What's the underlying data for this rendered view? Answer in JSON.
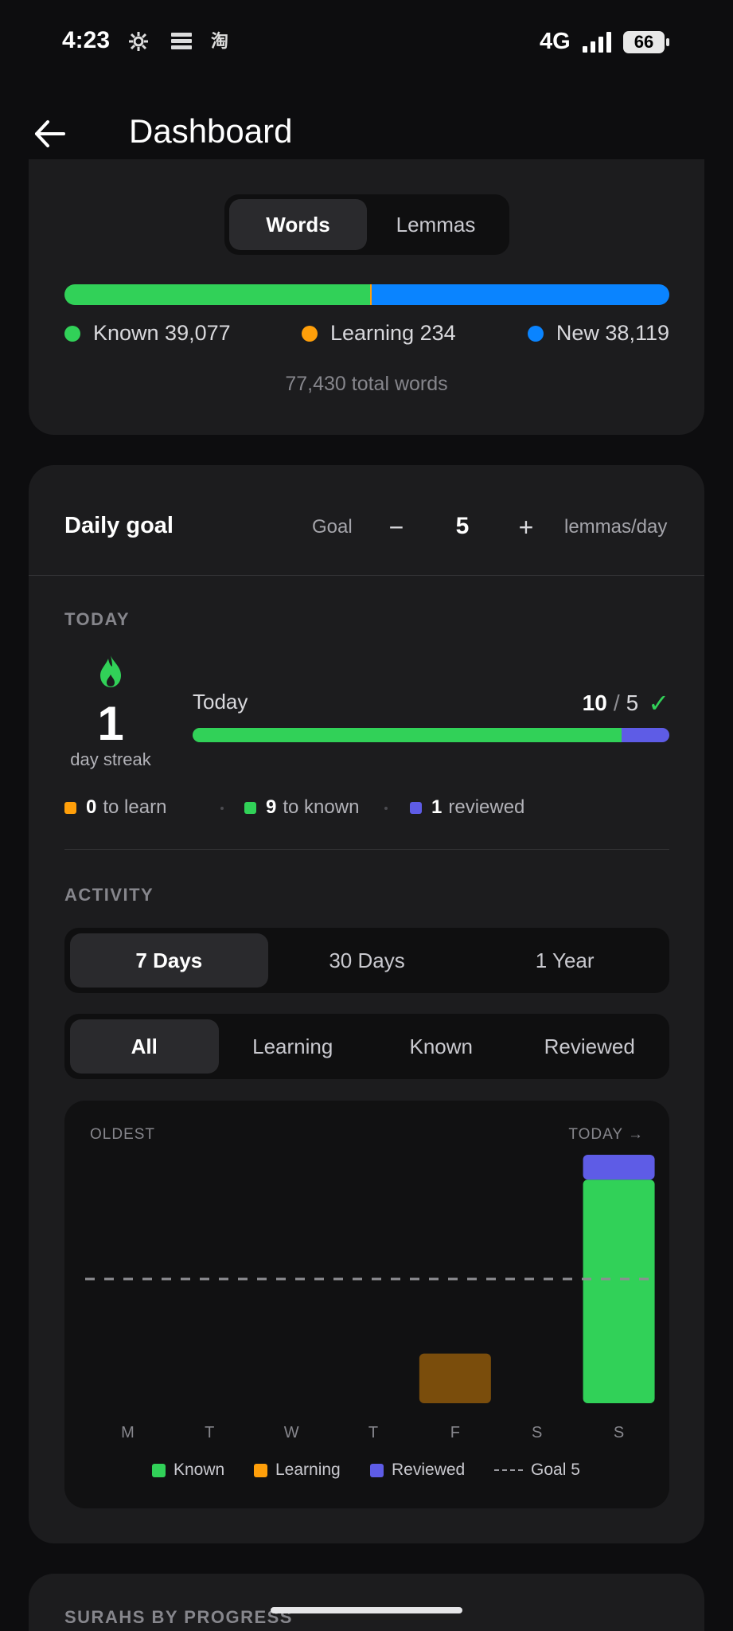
{
  "status_bar": {
    "time": "4:23",
    "notif_icons": [
      "settings-gear-icon",
      "stack-icon",
      "taobao-icon"
    ],
    "network": "4G",
    "battery": "66"
  },
  "header": {
    "title": "Dashboard",
    "back_icon": "arrow-left-icon"
  },
  "words_card": {
    "tabs": [
      {
        "label": "Words",
        "active": true
      },
      {
        "label": "Lemmas",
        "active": false
      }
    ],
    "breakdown": {
      "known": {
        "label": "Known 39,077",
        "value": 39077,
        "color": "#31d158"
      },
      "learning": {
        "label": "Learning 234",
        "value": 234,
        "color": "#ff9f0a"
      },
      "new": {
        "label": "New 38,119",
        "value": 38119,
        "color": "#0a84ff"
      }
    },
    "total_label": "77,430 total words"
  },
  "daily_goal": {
    "title": "Daily goal",
    "goal_label": "Goal",
    "minus": "−",
    "value": "5",
    "plus": "+",
    "unit": "lemmas/day",
    "today_section": "TODAY",
    "streak_value": "1",
    "streak_label": "day streak",
    "today_label": "Today",
    "today_done": "10",
    "today_sep": "/",
    "today_goal": "5",
    "check": "✓",
    "today_progress": {
      "known": 9,
      "reviewed": 1,
      "total": 10
    },
    "stats": [
      {
        "value": "0",
        "label": "to learn",
        "color": "#ff9f0a"
      },
      {
        "value": "9",
        "label": "to known",
        "color": "#31d158"
      },
      {
        "value": "1",
        "label": "reviewed",
        "color": "#5e5ce6"
      }
    ]
  },
  "activity": {
    "section": "ACTIVITY",
    "ranges": [
      {
        "label": "7 Days",
        "active": true
      },
      {
        "label": "30 Days",
        "active": false
      },
      {
        "label": "1 Year",
        "active": false
      }
    ],
    "filters": [
      {
        "label": "All",
        "active": true
      },
      {
        "label": "Learning",
        "active": false
      },
      {
        "label": "Known",
        "active": false
      },
      {
        "label": "Reviewed",
        "active": false
      }
    ],
    "oldest_label": "OLDEST",
    "today_label": "TODAY →",
    "legend": {
      "known": "Known",
      "learning": "Learning",
      "reviewed": "Reviewed",
      "goal": "Goal 5"
    }
  },
  "chart_data": {
    "type": "bar",
    "categories": [
      "M",
      "T",
      "W",
      "T",
      "F",
      "S",
      "S"
    ],
    "series": [
      {
        "name": "Known",
        "values": [
          0,
          0,
          0,
          0,
          0,
          0,
          9
        ],
        "color": "#31d158"
      },
      {
        "name": "Learning",
        "values": [
          0,
          0,
          0,
          0,
          2,
          0,
          0
        ],
        "color": "#7a4d0c"
      },
      {
        "name": "Reviewed",
        "values": [
          0,
          0,
          0,
          0,
          0,
          0,
          1
        ],
        "color": "#5e5ce6"
      }
    ],
    "goal": 5,
    "ylim": [
      0,
      10
    ],
    "stacked": true,
    "grid": false,
    "legend_position": "bottom"
  },
  "surahs": {
    "title": "SURAHS BY PROGRESS"
  }
}
